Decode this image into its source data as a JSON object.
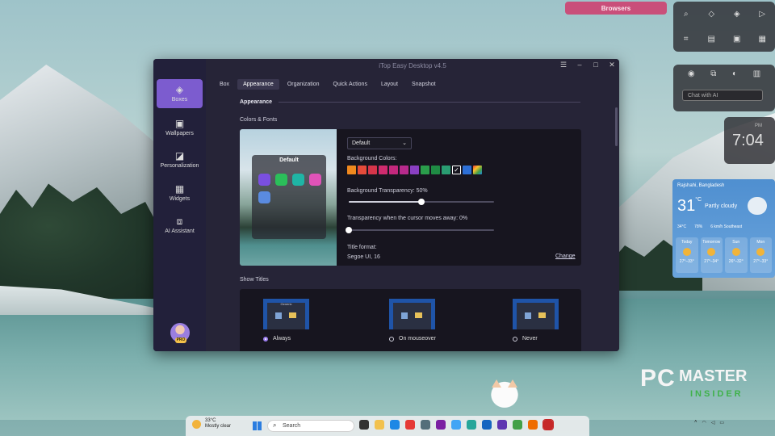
{
  "desktop": {
    "browsers_label": "Browsers",
    "chat_placeholder": "Chat with AI",
    "clock": {
      "ampm": "PM",
      "time": "7:04"
    },
    "weather": {
      "location": "Rajshahi, Bangladesh",
      "temp": "31",
      "unit": "°C",
      "condition": "Partly cloudy",
      "details": [
        "34°C",
        "78%",
        "6 km/h Southeast"
      ],
      "days": [
        {
          "name": "Today",
          "range": "27°–33°"
        },
        {
          "name": "Tomorrow",
          "range": "27°–34°"
        },
        {
          "name": "Sun",
          "range": "26°–32°"
        },
        {
          "name": "Mon",
          "range": "27°–33°"
        }
      ]
    }
  },
  "app": {
    "title": "iTop Easy Desktop v4.5",
    "sidebar": [
      {
        "label": "Boxes",
        "icon": "box-icon"
      },
      {
        "label": "Wallpapers",
        "icon": "image-icon"
      },
      {
        "label": "Personalization",
        "icon": "brush-icon"
      },
      {
        "label": "Widgets",
        "icon": "widgets-icon"
      },
      {
        "label": "AI Assistant",
        "icon": "ai-icon"
      }
    ],
    "pro_badge": "PRO",
    "tabs": [
      "Box",
      "Appearance",
      "Organization",
      "Quick Actions",
      "Layout",
      "Snapshot"
    ],
    "appearance": {
      "section_title": "Appearance",
      "colors_fonts_label": "Colors & Fonts",
      "preview_title": "Default",
      "theme_select": "Default",
      "background_colors_label": "Background Colors:",
      "swatches": [
        "#f0891e",
        "#e54b3a",
        "#d6354a",
        "#cf2b6e",
        "#c4287d",
        "#b72a8c",
        "#8a3fc2",
        "#2a9d4b",
        "#1f8b44",
        "#2a9d72",
        "#selected",
        "#2d6fd6",
        "#multi"
      ],
      "transparency_label": "Background Transparency: 50%",
      "transparency_value": 0.5,
      "cursor_transparency_label": "Transparency when the cursor moves away: 0%",
      "cursor_transparency_value": 0.0,
      "title_format_label": "Title format:",
      "title_format_value": "Segoe UI, 16",
      "change_link": "Change"
    },
    "show_titles": {
      "label": "Show Titles",
      "thumb_title": "Generic",
      "options": [
        {
          "label": "Always",
          "selected": true
        },
        {
          "label": "On mouseover",
          "selected": false
        },
        {
          "label": "Never",
          "selected": false
        }
      ]
    }
  },
  "taskbar": {
    "weather_temp": "33°C",
    "weather_cond": "Mostly clear",
    "search_placeholder": "Search"
  },
  "watermark": {
    "pc": "PC",
    "master": "MASTER",
    "insider": "INSIDER"
  }
}
